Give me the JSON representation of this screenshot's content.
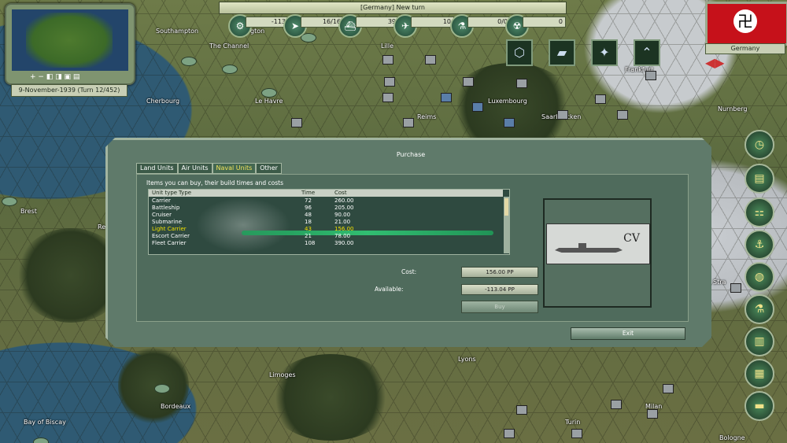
{
  "map": {
    "cities": [
      "Southampton",
      "The Channel",
      "Lille",
      "Cherbourg",
      "Le Havre",
      "Luxembourg",
      "Reims",
      "Saarbrücken",
      "Frankfurt",
      "Nurnberg",
      "Brest",
      "Limoges",
      "Lyons",
      "Bordeaux",
      "Bay of Biscay",
      "Turin",
      "Milan",
      "Bologne"
    ],
    "partial_city": "gton",
    "partial_city_2": "Re",
    "partial_city_3": "Stra"
  },
  "minimap": {
    "buttons": "+  −  ◧  ◨  ▣  ▤"
  },
  "date": "9-November-1939 (Turn 12/452)",
  "topbar": {
    "message": "[Germany] New turn"
  },
  "resources": [
    {
      "icon": "production-icon",
      "value": "-113"
    },
    {
      "icon": "fuel-icon",
      "value": "16/16"
    },
    {
      "icon": "naval-icon",
      "value": "39"
    },
    {
      "icon": "air-icon",
      "value": "10"
    },
    {
      "icon": "research-icon",
      "value": "0/0"
    },
    {
      "icon": "nuclear-icon",
      "value": "0"
    }
  ],
  "country": "Germany",
  "dialog": {
    "title": "Purchase",
    "tabs": [
      "Land Units",
      "Air Units",
      "Naval Units",
      "Other"
    ],
    "active_tab": "Naval Units",
    "hint": "Items you can buy, their build times and costs",
    "columns": [
      "Unit type",
      "Type",
      "Time",
      "Cost"
    ],
    "rows": [
      {
        "name": "Carrier",
        "time": "72",
        "cost": "260.00"
      },
      {
        "name": "Battleship",
        "time": "96",
        "cost": "205.00"
      },
      {
        "name": "Cruiser",
        "time": "48",
        "cost": "90.00"
      },
      {
        "name": "Submarine",
        "time": "18",
        "cost": "21.00"
      },
      {
        "name": "Light Carrier",
        "time": "43",
        "cost": "156.00",
        "selected": true
      },
      {
        "name": "Escort Carrier",
        "time": "21",
        "cost": "78.00"
      },
      {
        "name": "Fleet Carrier",
        "time": "108",
        "cost": "390.00"
      }
    ],
    "preview_label": "CV",
    "cost_label": "Cost:",
    "cost_value": "156.00 PP",
    "available_label": "Available:",
    "available_value": "-113.04 PP",
    "buy_label": "Buy",
    "exit_label": "Exit"
  },
  "colors": {
    "selected_text": "#f0e000",
    "active_tab": "#f1e35a",
    "flag_red": "#c6111a"
  }
}
